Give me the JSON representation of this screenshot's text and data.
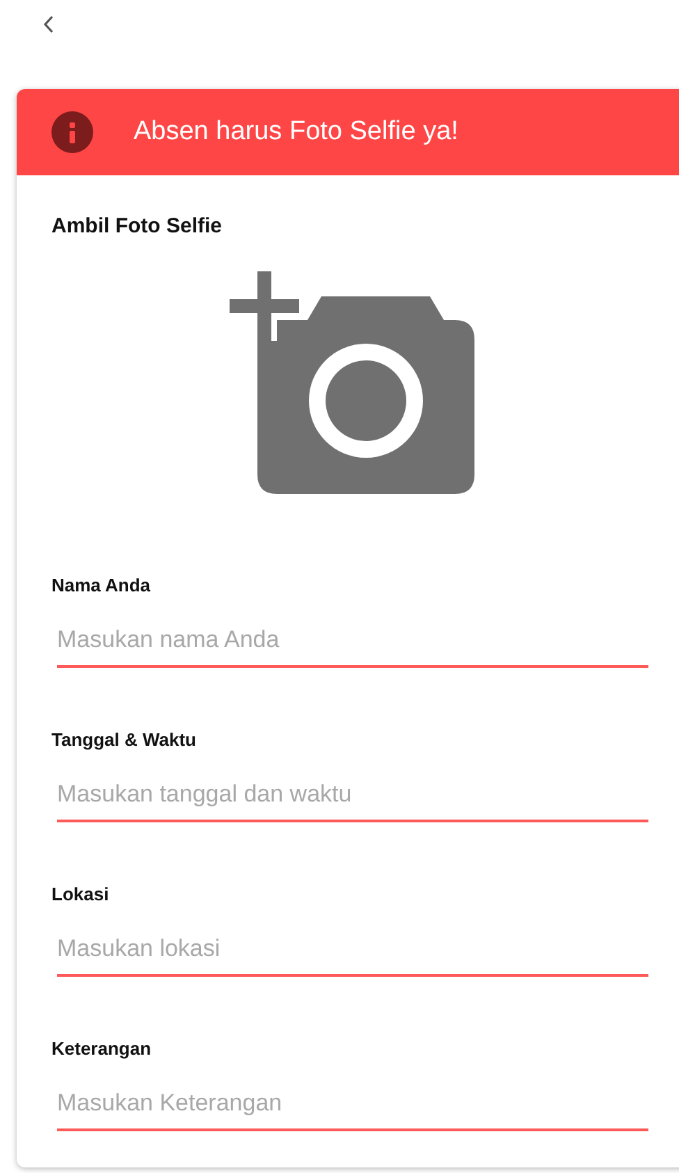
{
  "alert": {
    "message": "Absen harus Foto Selfie ya!"
  },
  "photo": {
    "label": "Ambil Foto Selfie"
  },
  "fields": [
    {
      "label": "Nama Anda",
      "placeholder": "Masukan nama Anda"
    },
    {
      "label": "Tanggal & Waktu",
      "placeholder": "Masukan tanggal dan waktu"
    },
    {
      "label": "Lokasi",
      "placeholder": "Masukan lokasi"
    },
    {
      "label": "Keterangan",
      "placeholder": "Masukan Keterangan"
    }
  ]
}
